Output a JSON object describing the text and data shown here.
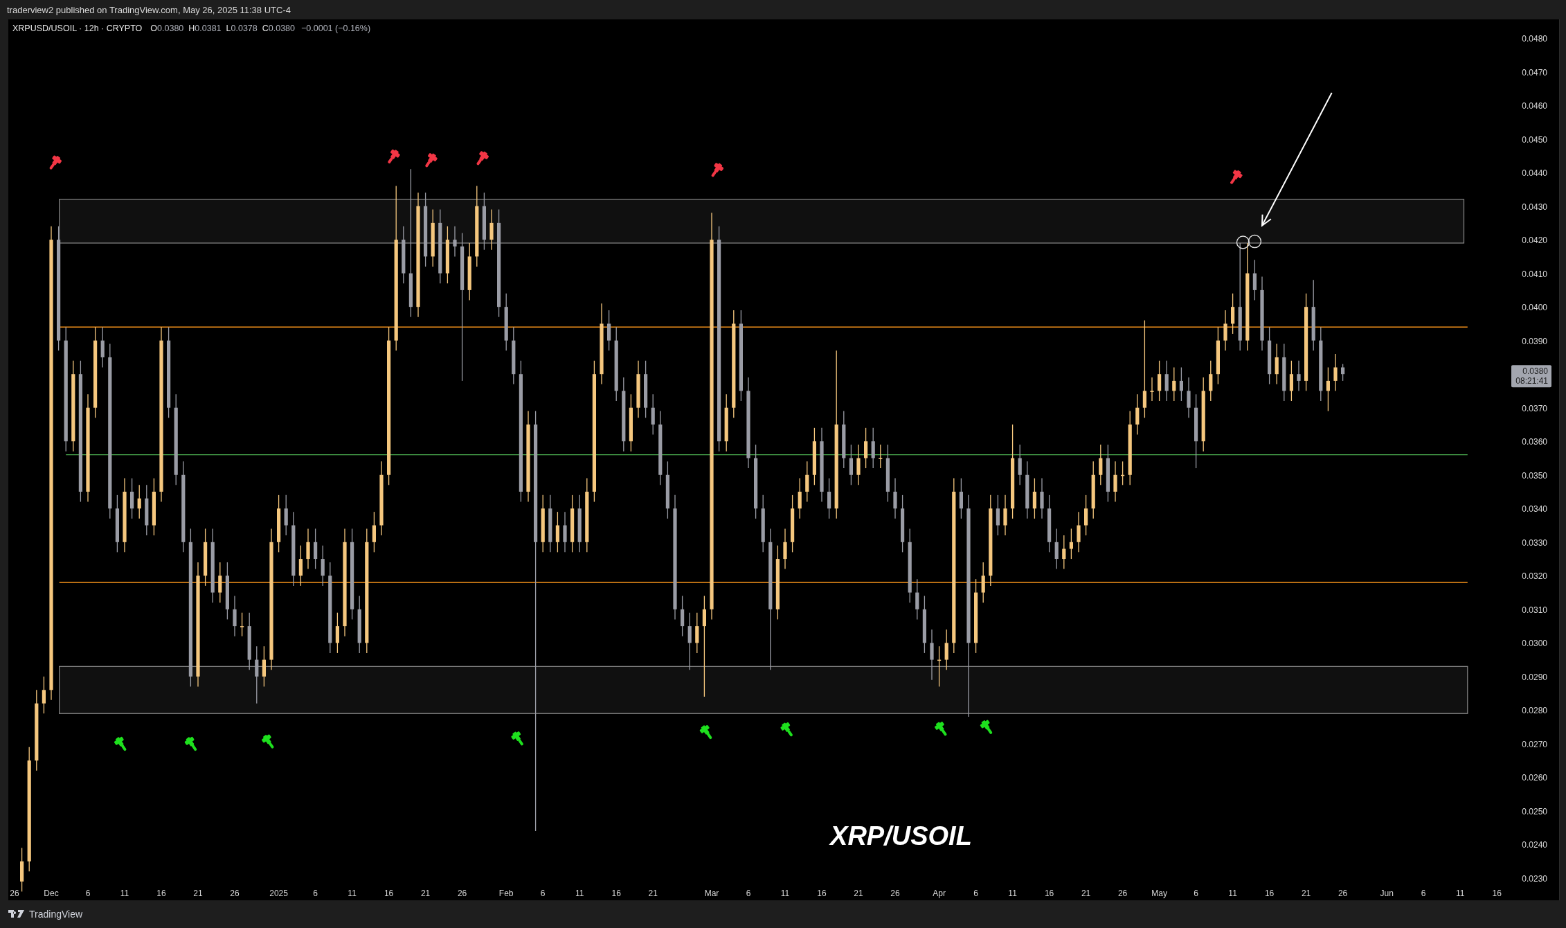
{
  "publish_bar": {
    "text": "traderview2 published on TradingView.com, May 26, 2025 11:38 UTC-4"
  },
  "legend": {
    "symbol_suffix": "· 12h · CRYPTO",
    "ohlc": [
      {
        "label": "O",
        "value": "0.0380"
      },
      {
        "label": "H",
        "value": "0.0381"
      },
      {
        "label": "L",
        "value": "0.0378"
      },
      {
        "label": "C",
        "value": "0.0380"
      }
    ],
    "change": "−0.0001 (−0.16%)"
  },
  "chart": {
    "caption": "XRP/USOIL",
    "chart_data": {
      "type": "candlestick",
      "title": "XRPUSD/USOIL",
      "ylim": [
        0.023,
        0.048
      ],
      "ref_lines": [
        {
          "axis": "y",
          "value": 0.0394,
          "color": "#f7931a"
        },
        {
          "axis": "y",
          "value": 0.0318,
          "color": "#f7931a"
        },
        {
          "axis": "y",
          "value": 0.0356,
          "color": "#4caf50"
        }
      ],
      "categories": [
        "26",
        null,
        null,
        null,
        null,
        "Dec",
        null,
        null,
        null,
        null,
        "6",
        null,
        null,
        null,
        null,
        "11",
        null,
        null,
        null,
        null,
        "16",
        null,
        null,
        null,
        null,
        "21",
        null,
        null,
        null,
        null,
        "26",
        null,
        null,
        null,
        null,
        null,
        "2025",
        null,
        null,
        null,
        null,
        "6",
        null,
        null,
        null,
        null,
        "11",
        null,
        null,
        null,
        null,
        "16",
        null,
        null,
        null,
        null,
        "21",
        null,
        null,
        null,
        null,
        "26",
        null,
        null,
        null,
        null,
        null,
        "Feb",
        null,
        null,
        null,
        null,
        "6",
        null,
        null,
        null,
        null,
        "11",
        null,
        null,
        null,
        null,
        "16",
        null,
        null,
        null,
        null,
        "21",
        null,
        null,
        null,
        null,
        null,
        null,
        null,
        "Mar",
        null,
        null,
        null,
        null,
        "6",
        null,
        null,
        null,
        null,
        "11",
        null,
        null,
        null,
        null,
        "16",
        null,
        null,
        null,
        null,
        "21",
        null,
        null,
        null,
        null,
        "26",
        null,
        null,
        null,
        null,
        null,
        "Apr",
        null,
        null,
        null,
        null,
        "6",
        null,
        null,
        null,
        null,
        "11",
        null,
        null,
        null,
        null,
        "16",
        null,
        null,
        null,
        null,
        "21",
        null,
        null,
        null,
        null,
        "26",
        null,
        null,
        null,
        null,
        "May",
        null,
        null,
        null,
        null,
        "6",
        null,
        null,
        null,
        null,
        "11",
        null,
        null,
        null,
        null,
        "16",
        null,
        null,
        null,
        null,
        "21",
        null,
        null,
        null,
        null,
        "26",
        null,
        null,
        null,
        null,
        null,
        "Jun",
        null,
        null,
        null,
        null,
        "6",
        null,
        null,
        null,
        null,
        "11",
        null,
        null,
        null,
        null,
        "16"
      ],
      "ohlc": [
        null,
        [
          0.0229,
          0.0239,
          0.0226,
          0.0235
        ],
        [
          0.0235,
          0.0269,
          0.0232,
          0.0265
        ],
        [
          0.0265,
          0.0286,
          0.0262,
          0.0282
        ],
        [
          0.0282,
          0.029,
          0.0279,
          0.0286
        ],
        [
          0.0286,
          0.0424,
          0.0283,
          0.042
        ],
        [
          0.042,
          0.0424,
          0.0387,
          0.039
        ],
        [
          0.039,
          0.0394,
          0.0357,
          0.036
        ],
        [
          0.036,
          0.0384,
          0.0357,
          0.038
        ],
        [
          0.038,
          0.0384,
          0.0342,
          0.0345
        ],
        [
          0.0345,
          0.0374,
          0.0342,
          0.037
        ],
        [
          0.037,
          0.0394,
          0.0367,
          0.039
        ],
        [
          0.039,
          0.0394,
          0.0382,
          0.0385
        ],
        [
          0.0385,
          0.0389,
          0.0337,
          0.034
        ],
        [
          0.034,
          0.0344,
          0.0327,
          0.033
        ],
        [
          0.033,
          0.0349,
          0.0327,
          0.0345
        ],
        [
          0.0345,
          0.0349,
          0.0337,
          0.034
        ],
        [
          0.034,
          0.0347,
          0.0337,
          0.0343
        ],
        [
          0.0343,
          0.0347,
          0.0332,
          0.0335
        ],
        [
          0.0335,
          0.0349,
          0.0332,
          0.0345
        ],
        [
          0.0345,
          0.0394,
          0.0342,
          0.039
        ],
        [
          0.039,
          0.0394,
          0.0367,
          0.037
        ],
        [
          0.037,
          0.0374,
          0.0347,
          0.035
        ],
        [
          0.035,
          0.0354,
          0.0327,
          0.033
        ],
        [
          0.033,
          0.0334,
          0.0287,
          0.029
        ],
        [
          0.029,
          0.0324,
          0.0287,
          0.032
        ],
        [
          0.032,
          0.0334,
          0.0317,
          0.033
        ],
        [
          0.033,
          0.0334,
          0.0312,
          0.0315
        ],
        [
          0.0315,
          0.0324,
          0.0312,
          0.032
        ],
        [
          0.032,
          0.0324,
          0.0307,
          0.031
        ],
        [
          0.031,
          0.0314,
          0.0302,
          0.0305
        ],
        [
          0.0305,
          0.0309,
          0.0302,
          0.0305
        ],
        [
          0.0305,
          0.0309,
          0.0292,
          0.0295
        ],
        [
          0.0295,
          0.0299,
          0.0282,
          0.029
        ],
        [
          0.029,
          0.0299,
          0.0287,
          0.0295
        ],
        [
          0.0295,
          0.0334,
          0.0292,
          0.033
        ],
        [
          0.033,
          0.0344,
          0.0327,
          0.034
        ],
        [
          0.034,
          0.0344,
          0.0332,
          0.0335
        ],
        [
          0.0335,
          0.0339,
          0.0317,
          0.032
        ],
        [
          0.032,
          0.0329,
          0.0317,
          0.0325
        ],
        [
          0.0325,
          0.0334,
          0.0322,
          0.033
        ],
        [
          0.033,
          0.0334,
          0.0322,
          0.0325
        ],
        [
          0.0325,
          0.0329,
          0.0317,
          0.032
        ],
        [
          0.032,
          0.0324,
          0.0297,
          0.03
        ],
        [
          0.03,
          0.0309,
          0.0297,
          0.0305
        ],
        [
          0.0305,
          0.0334,
          0.0302,
          0.033
        ],
        [
          0.033,
          0.0334,
          0.0307,
          0.031
        ],
        [
          0.031,
          0.0314,
          0.0297,
          0.03
        ],
        [
          0.03,
          0.0334,
          0.0297,
          0.033
        ],
        [
          0.033,
          0.0339,
          0.0327,
          0.0335
        ],
        [
          0.0335,
          0.0354,
          0.0332,
          0.035
        ],
        [
          0.035,
          0.0394,
          0.0347,
          0.039
        ],
        [
          0.039,
          0.0436,
          0.0387,
          0.042
        ],
        [
          0.042,
          0.0424,
          0.0407,
          0.041
        ],
        [
          0.041,
          0.0441,
          0.0397,
          0.04
        ],
        [
          0.04,
          0.0434,
          0.0397,
          0.043
        ],
        [
          0.043,
          0.0434,
          0.0412,
          0.0415
        ],
        [
          0.0415,
          0.0429,
          0.0412,
          0.0425
        ],
        [
          0.0425,
          0.0429,
          0.0407,
          0.041
        ],
        [
          0.041,
          0.0424,
          0.0407,
          0.042
        ],
        [
          0.042,
          0.0424,
          0.0415,
          0.0418
        ],
        [
          0.0418,
          0.0422,
          0.0378,
          0.0405
        ],
        [
          0.0405,
          0.0419,
          0.0402,
          0.0415
        ],
        [
          0.0415,
          0.0436,
          0.0412,
          0.043
        ],
        [
          0.043,
          0.0434,
          0.0417,
          0.042
        ],
        [
          0.042,
          0.0429,
          0.0417,
          0.0425
        ],
        [
          0.0425,
          0.0429,
          0.0397,
          0.04
        ],
        [
          0.04,
          0.0404,
          0.0387,
          0.039
        ],
        [
          0.039,
          0.0394,
          0.0377,
          0.038
        ],
        [
          0.038,
          0.0384,
          0.0342,
          0.0345
        ],
        [
          0.0345,
          0.0369,
          0.0342,
          0.0365
        ],
        [
          0.0365,
          0.0369,
          0.0244,
          0.033
        ],
        [
          0.033,
          0.0344,
          0.0327,
          0.034
        ],
        [
          0.034,
          0.0344,
          0.0327,
          0.033
        ],
        [
          0.033,
          0.0339,
          0.0327,
          0.0335
        ],
        [
          0.0335,
          0.0339,
          0.0327,
          0.033
        ],
        [
          0.033,
          0.0344,
          0.0327,
          0.034
        ],
        [
          0.034,
          0.0344,
          0.0327,
          0.033
        ],
        [
          0.033,
          0.0349,
          0.0327,
          0.0345
        ],
        [
          0.0345,
          0.0384,
          0.0342,
          0.038
        ],
        [
          0.038,
          0.0401,
          0.0377,
          0.0395
        ],
        [
          0.0395,
          0.0399,
          0.0387,
          0.039
        ],
        [
          0.039,
          0.0394,
          0.0372,
          0.0375
        ],
        [
          0.0375,
          0.0379,
          0.0357,
          0.036
        ],
        [
          0.036,
          0.0374,
          0.0357,
          0.037
        ],
        [
          0.037,
          0.0384,
          0.0367,
          0.038
        ],
        [
          0.038,
          0.0384,
          0.0367,
          0.037
        ],
        [
          0.037,
          0.0374,
          0.0362,
          0.0365
        ],
        [
          0.0365,
          0.0369,
          0.0347,
          0.035
        ],
        [
          0.035,
          0.0354,
          0.0337,
          0.034
        ],
        [
          0.034,
          0.0344,
          0.0307,
          0.031
        ],
        [
          0.031,
          0.0314,
          0.0302,
          0.0305
        ],
        [
          0.0305,
          0.0309,
          0.0292,
          0.03
        ],
        [
          0.03,
          0.0309,
          0.0297,
          0.0305
        ],
        [
          0.0305,
          0.0314,
          0.0284,
          0.031
        ],
        [
          0.031,
          0.0428,
          0.0307,
          0.042
        ],
        [
          0.042,
          0.0424,
          0.0357,
          0.036
        ],
        [
          0.036,
          0.0374,
          0.0357,
          0.037
        ],
        [
          0.037,
          0.0399,
          0.0367,
          0.0395
        ],
        [
          0.0395,
          0.0399,
          0.0372,
          0.0375
        ],
        [
          0.0375,
          0.0379,
          0.0352,
          0.0355
        ],
        [
          0.0355,
          0.0359,
          0.0337,
          0.034
        ],
        [
          0.034,
          0.0344,
          0.0327,
          0.033
        ],
        [
          0.033,
          0.0334,
          0.0292,
          0.031
        ],
        [
          0.031,
          0.0329,
          0.0307,
          0.0325
        ],
        [
          0.0325,
          0.0334,
          0.0322,
          0.033
        ],
        [
          0.033,
          0.0344,
          0.0327,
          0.034
        ],
        [
          0.034,
          0.0349,
          0.0337,
          0.0345
        ],
        [
          0.0345,
          0.0354,
          0.0342,
          0.035
        ],
        [
          0.035,
          0.0364,
          0.0347,
          0.036
        ],
        [
          0.036,
          0.0364,
          0.0342,
          0.0345
        ],
        [
          0.0345,
          0.0349,
          0.0337,
          0.034
        ],
        [
          0.034,
          0.0387,
          0.0337,
          0.0365
        ],
        [
          0.0365,
          0.0369,
          0.0352,
          0.0355
        ],
        [
          0.0355,
          0.0359,
          0.0347,
          0.035
        ],
        [
          0.035,
          0.0359,
          0.0347,
          0.0355
        ],
        [
          0.0355,
          0.0364,
          0.0352,
          0.036
        ],
        [
          0.036,
          0.0364,
          0.0352,
          0.0355
        ],
        [
          0.0355,
          0.0359,
          0.0352,
          0.0355
        ],
        [
          0.0355,
          0.0359,
          0.0342,
          0.0345
        ],
        [
          0.0345,
          0.0349,
          0.0337,
          0.034
        ],
        [
          0.034,
          0.0344,
          0.0327,
          0.033
        ],
        [
          0.033,
          0.0334,
          0.0312,
          0.0315
        ],
        [
          0.0315,
          0.0319,
          0.0307,
          0.031
        ],
        [
          0.031,
          0.0314,
          0.0297,
          0.03
        ],
        [
          0.03,
          0.0304,
          0.0289,
          0.0295
        ],
        [
          0.0295,
          0.0299,
          0.0287,
          0.0295
        ],
        [
          0.0295,
          0.0304,
          0.0292,
          0.03
        ],
        [
          0.03,
          0.0349,
          0.0297,
          0.0345
        ],
        [
          0.0345,
          0.0349,
          0.0337,
          0.034
        ],
        [
          0.034,
          0.0344,
          0.0278,
          0.03
        ],
        [
          0.03,
          0.0319,
          0.0297,
          0.0315
        ],
        [
          0.0315,
          0.0324,
          0.0312,
          0.032
        ],
        [
          0.032,
          0.0344,
          0.0317,
          0.034
        ],
        [
          0.034,
          0.0344,
          0.0332,
          0.0335
        ],
        [
          0.0335,
          0.0344,
          0.0332,
          0.034
        ],
        [
          0.034,
          0.0365,
          0.0337,
          0.0355
        ],
        [
          0.0355,
          0.0359,
          0.0347,
          0.035
        ],
        [
          0.035,
          0.0354,
          0.0337,
          0.034
        ],
        [
          0.034,
          0.0349,
          0.0337,
          0.0345
        ],
        [
          0.0345,
          0.0349,
          0.0337,
          0.034
        ],
        [
          0.034,
          0.0344,
          0.0327,
          0.033
        ],
        [
          0.033,
          0.0334,
          0.0322,
          0.0325
        ],
        [
          0.0325,
          0.0332,
          0.0322,
          0.0328
        ],
        [
          0.0328,
          0.0334,
          0.0325,
          0.033
        ],
        [
          0.033,
          0.0339,
          0.0327,
          0.0335
        ],
        [
          0.0335,
          0.0344,
          0.0332,
          0.034
        ],
        [
          0.034,
          0.0354,
          0.0337,
          0.035
        ],
        [
          0.035,
          0.0359,
          0.0347,
          0.0355
        ],
        [
          0.0355,
          0.0359,
          0.0342,
          0.0345
        ],
        [
          0.0345,
          0.0354,
          0.0342,
          0.035
        ],
        [
          0.035,
          0.0354,
          0.0347,
          0.035
        ],
        [
          0.035,
          0.0369,
          0.0347,
          0.0365
        ],
        [
          0.0365,
          0.0374,
          0.0362,
          0.037
        ],
        [
          0.037,
          0.0396,
          0.0367,
          0.0375
        ],
        [
          0.0375,
          0.0379,
          0.0372,
          0.0375
        ],
        [
          0.0375,
          0.0384,
          0.0372,
          0.038
        ],
        [
          0.038,
          0.0384,
          0.0372,
          0.0375
        ],
        [
          0.0375,
          0.0382,
          0.0372,
          0.0378
        ],
        [
          0.0378,
          0.0382,
          0.0372,
          0.0375
        ],
        [
          0.0375,
          0.0379,
          0.0367,
          0.037
        ],
        [
          0.037,
          0.0374,
          0.0352,
          0.036
        ],
        [
          0.036,
          0.0379,
          0.0357,
          0.0375
        ],
        [
          0.0375,
          0.0384,
          0.0372,
          0.038
        ],
        [
          0.038,
          0.0394,
          0.0377,
          0.039
        ],
        [
          0.039,
          0.0399,
          0.0387,
          0.0395
        ],
        [
          0.0395,
          0.0404,
          0.0392,
          0.04
        ],
        [
          0.04,
          0.0419,
          0.0387,
          0.039
        ],
        [
          0.039,
          0.0419,
          0.0387,
          0.041
        ],
        [
          0.041,
          0.0414,
          0.0402,
          0.0405
        ],
        [
          0.0405,
          0.0409,
          0.0387,
          0.039
        ],
        [
          0.039,
          0.0394,
          0.0377,
          0.038
        ],
        [
          0.038,
          0.0389,
          0.0377,
          0.0385
        ],
        [
          0.0385,
          0.0389,
          0.0372,
          0.0375
        ],
        [
          0.0375,
          0.0384,
          0.0372,
          0.038
        ],
        [
          0.038,
          0.0384,
          0.0375,
          0.0378
        ],
        [
          0.0378,
          0.0404,
          0.0375,
          0.04
        ],
        [
          0.04,
          0.0408,
          0.0387,
          0.039
        ],
        [
          0.039,
          0.0394,
          0.0372,
          0.0375
        ],
        [
          0.0375,
          0.0382,
          0.0369,
          0.0378
        ],
        [
          0.0378,
          0.0386,
          0.0375,
          0.0382
        ],
        [
          0.0382,
          0.0383,
          0.0378,
          0.038
        ],
        null,
        null,
        null,
        null,
        null,
        null,
        null,
        null,
        null,
        null,
        null,
        null,
        null,
        null,
        null,
        null,
        null,
        null,
        null,
        null,
        null
      ],
      "yticks": [
        {
          "value": 0.048,
          "label": "0.0480"
        },
        {
          "value": 0.047,
          "label": "0.0470"
        },
        {
          "value": 0.046,
          "label": "0.0460"
        },
        {
          "value": 0.045,
          "label": "0.0450"
        },
        {
          "value": 0.044,
          "label": "0.0440"
        },
        {
          "value": 0.043,
          "label": "0.0430"
        },
        {
          "value": 0.042,
          "label": "0.0420"
        },
        {
          "value": 0.041,
          "label": "0.0410"
        },
        {
          "value": 0.04,
          "label": "0.0400"
        },
        {
          "value": 0.039,
          "label": "0.0390"
        },
        {
          "value": 0.037,
          "label": "0.0370"
        },
        {
          "value": 0.036,
          "label": "0.0360"
        },
        {
          "value": 0.035,
          "label": "0.0350"
        },
        {
          "value": 0.034,
          "label": "0.0340"
        },
        {
          "value": 0.033,
          "label": "0.0330"
        },
        {
          "value": 0.032,
          "label": "0.0320"
        },
        {
          "value": 0.031,
          "label": "0.0310"
        },
        {
          "value": 0.03,
          "label": "0.0300"
        },
        {
          "value": 0.029,
          "label": "0.0290"
        },
        {
          "value": 0.028,
          "label": "0.0280"
        },
        {
          "value": 0.027,
          "label": "0.0270"
        },
        {
          "value": 0.026,
          "label": "0.0260"
        },
        {
          "value": 0.025,
          "label": "0.0250"
        },
        {
          "value": 0.024,
          "label": "0.0240"
        },
        {
          "value": 0.023,
          "label": "0.0230"
        }
      ]
    },
    "price_tag": {
      "price": "0.0380",
      "countdown": "08:21:41"
    }
  },
  "footer": {
    "brand": "TradingView"
  }
}
